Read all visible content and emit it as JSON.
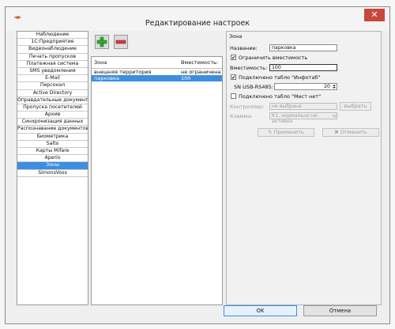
{
  "window": {
    "title": "Редактирование настроек",
    "close_glyph": "✕"
  },
  "sidebar": {
    "items": [
      "Наблюдение",
      "1С:Предприятие",
      "Видеонаблюдение",
      "Печать пропусков",
      "Платежная система",
      "SMS уведомления",
      "E-Mail",
      "Персонал",
      "Active Directory",
      "Оправдательные документы",
      "Пропуска посетителей",
      "Архив",
      "Синхронизация данных",
      "Распознавание документов",
      "Биометрика",
      "Salto",
      "Карты Mifare",
      "Aperio",
      "Зоны",
      "SimonsVoss"
    ],
    "selected_index": 18
  },
  "zones_table": {
    "headers": [
      "Зона",
      "Вместимость:"
    ],
    "rows": [
      [
        "внешняя территория",
        "не ограничена"
      ],
      [
        "парковка",
        "100"
      ]
    ],
    "selected_index": 1
  },
  "zone_panel": {
    "group_title": "Зона",
    "name_label": "Название:",
    "name_value": "парковка",
    "limit_label": "Ограничить вместимость",
    "limit_checked": true,
    "capacity_label": "Вместимость:",
    "capacity_value": "100",
    "infotab_label": "Подключено табло \"Инфотаб\"",
    "infotab_checked": true,
    "sn_label": "SN USB-RS485:",
    "sn_value": "20",
    "mestnet_label": "Подключено табло \"Мест нет\"",
    "mestnet_checked": false,
    "controller_label": "Контроллер:",
    "controller_value": "не выбрана",
    "controller_btn": "выбрать",
    "key_label": "Клемма:",
    "key_value": "К1, нормально не активен",
    "apply_btn": "Применить",
    "cancel_btn": "Отменить"
  },
  "footer": {
    "ok": "OK",
    "cancel": "Отмена"
  },
  "colors": {
    "accent": "#3d8ee0",
    "add_green": "#2faa2f",
    "delete_red": "#d23b3b"
  }
}
